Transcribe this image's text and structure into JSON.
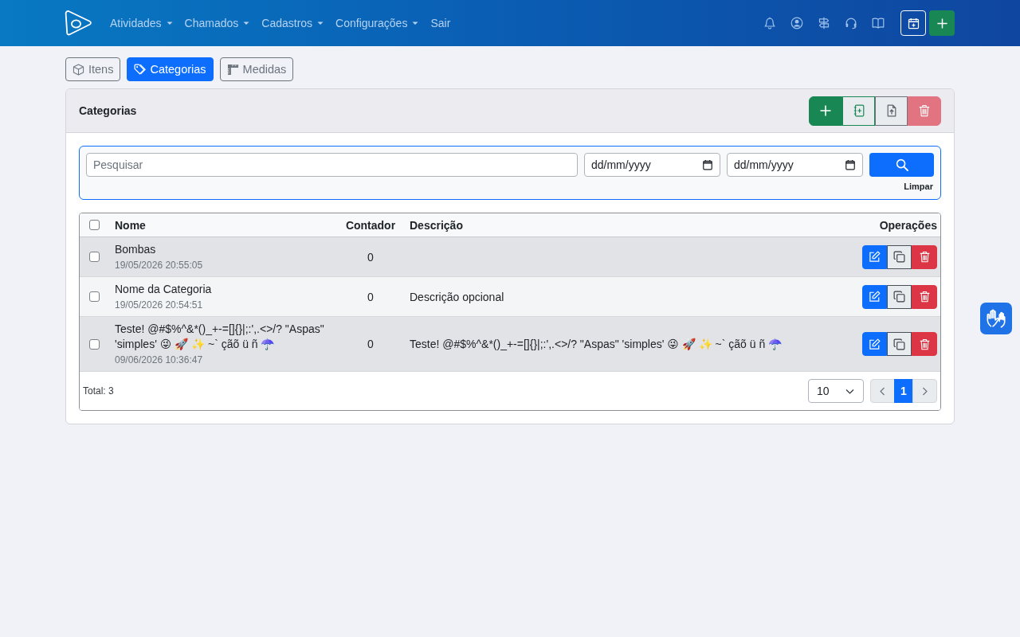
{
  "navbar": {
    "menu": [
      {
        "label": "Atividades",
        "dropdown": true
      },
      {
        "label": "Chamados",
        "dropdown": true
      },
      {
        "label": "Cadastros",
        "dropdown": true
      },
      {
        "label": "Configurações",
        "dropdown": true
      },
      {
        "label": "Sair",
        "dropdown": false
      }
    ]
  },
  "tabs": [
    {
      "label": "Itens",
      "selected": false
    },
    {
      "label": "Categorias",
      "selected": true
    },
    {
      "label": "Medidas",
      "selected": false
    }
  ],
  "card": {
    "title": "Categorias",
    "actions": [
      {
        "kind": "add",
        "disabled": false
      },
      {
        "kind": "import",
        "disabled": false
      },
      {
        "kind": "export",
        "disabled": false
      },
      {
        "kind": "delete",
        "disabled": true
      }
    ]
  },
  "filters": {
    "search": {
      "placeholder": "Pesquisar"
    },
    "date_from": {
      "placeholder": "dd/mm/yyyy"
    },
    "date_to": {
      "placeholder": "dd/mm/yyyy"
    },
    "clear_link": "Limpar"
  },
  "table": {
    "all_checked": false,
    "columns": [
      "Nome",
      "Contador",
      "Descrição",
      "Operações"
    ],
    "rows": [
      {
        "checked": false,
        "name": "Bombas",
        "timestamp": "19/05/2026 20:55:05",
        "count": "0"
      },
      {
        "checked": false,
        "name": "Nome da Categoria",
        "timestamp": "19/05/2026 20:54:51",
        "count": "0",
        "description": "Descrição opcional"
      },
      {
        "checked": false,
        "name": "Teste! @#$%^&*()_+-=[]{}|;:',.<>/? \"Aspas\" 'simples' 😜 🚀 ✨ ~` çãõ ü ñ ☂️",
        "timestamp": "09/06/2026 10:36:47",
        "count": "0",
        "description": "Teste! @#$%^&*()_+-=[]{}|;:',.<>/? \"Aspas\" 'simples' 😜 🚀 ✨ ~` çãõ ü ñ ☂️"
      }
    ],
    "footer": {
      "total": "Total: 3",
      "page_size": "10",
      "previous_disabled": true,
      "next_disabled": true,
      "pages": [
        {
          "label": "1",
          "selected": true
        }
      ]
    }
  }
}
